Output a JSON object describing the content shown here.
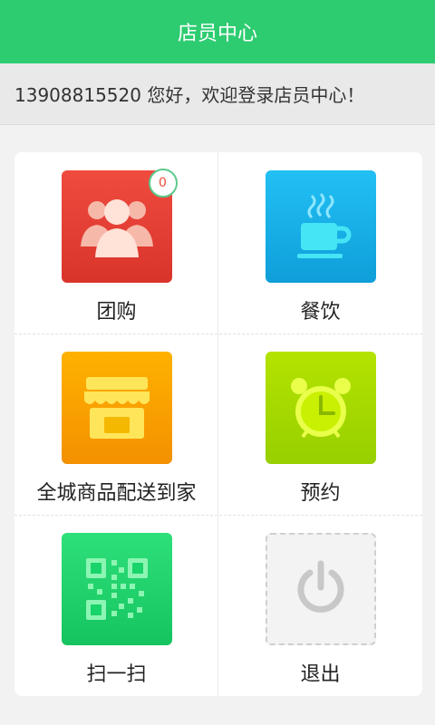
{
  "header": {
    "title": "店员中心"
  },
  "welcome": {
    "text": "13908815520 您好，欢迎登录店员中心！"
  },
  "grid": {
    "items": [
      {
        "label": "团购",
        "badge": "0",
        "color": "#e9443b",
        "icon": "group-icon"
      },
      {
        "label": "餐饮",
        "color": "#17aee8",
        "icon": "coffee-cup-icon"
      },
      {
        "label": "全城商品配送到家",
        "color": "#f6a000",
        "icon": "shop-icon"
      },
      {
        "label": "预约",
        "color": "#a6d800",
        "icon": "alarm-clock-icon"
      },
      {
        "label": "扫一扫",
        "color": "#19d36b",
        "icon": "qr-code-icon"
      },
      {
        "label": "退出",
        "color": "#f3f3f3",
        "icon": "power-icon"
      }
    ]
  },
  "colors": {
    "header_bg": "#2ecc71",
    "page_bg": "#f2f2f2"
  }
}
